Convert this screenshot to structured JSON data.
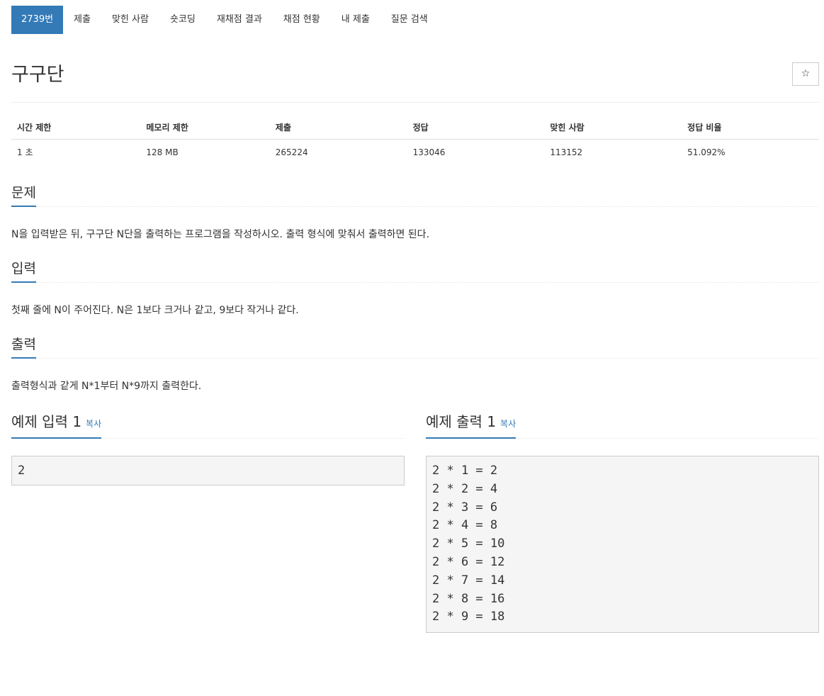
{
  "tabs": [
    {
      "label": "2739번",
      "active": true
    },
    {
      "label": "제출"
    },
    {
      "label": "맞힌 사람"
    },
    {
      "label": "숏코딩"
    },
    {
      "label": "재채점 결과"
    },
    {
      "label": "채점 현황"
    },
    {
      "label": "내 제출"
    },
    {
      "label": "질문 검색"
    }
  ],
  "title": "구구단",
  "star_icon": "☆",
  "info": {
    "headers": [
      "시간 제한",
      "메모리 제한",
      "제출",
      "정답",
      "맞힌 사람",
      "정답 비율"
    ],
    "values": [
      "1 초",
      "128 MB",
      "265224",
      "133046",
      "113152",
      "51.092%"
    ]
  },
  "sections": {
    "problem": {
      "heading": "문제",
      "body": "N을 입력받은 뒤, 구구단 N단을 출력하는 프로그램을 작성하시오. 출력 형식에 맞춰서 출력하면 된다."
    },
    "input": {
      "heading": "입력",
      "body": "첫째 줄에 N이 주어진다. N은 1보다 크거나 같고, 9보다 작거나 같다."
    },
    "output": {
      "heading": "출력",
      "body": "출력형식과 같게 N*1부터 N*9까지 출력한다."
    }
  },
  "samples": {
    "input": {
      "heading": "예제 입력 1",
      "copy": "복사",
      "data": "2"
    },
    "output": {
      "heading": "예제 출력 1",
      "copy": "복사",
      "data": "2 * 1 = 2\n2 * 2 = 4\n2 * 3 = 6\n2 * 4 = 8\n2 * 5 = 10\n2 * 6 = 12\n2 * 7 = 14\n2 * 8 = 16\n2 * 9 = 18"
    }
  },
  "colors": {
    "accent": "#337ab7",
    "sample_bg": "#f5f5f5"
  }
}
